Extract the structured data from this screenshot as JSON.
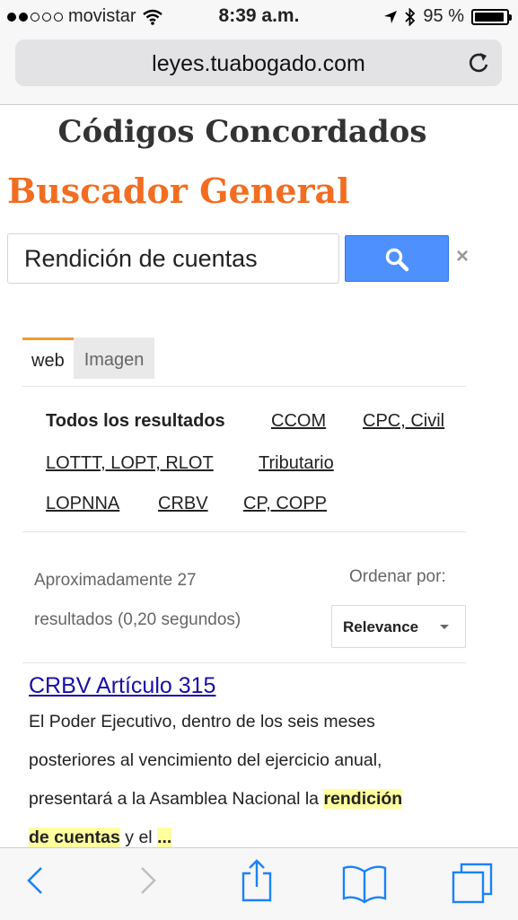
{
  "status_bar": {
    "carrier": "movistar",
    "time": "8:39 a.m.",
    "battery": "95 %",
    "battery_level": 0.95
  },
  "browser": {
    "url": "leyes.tuabogado.com"
  },
  "page": {
    "site_title": "Códigos Concordados",
    "search_heading": "Buscador General"
  },
  "search": {
    "value": "Rendición de cuentas",
    "clear_label": "×"
  },
  "tabs": [
    {
      "label": "web",
      "active": true
    },
    {
      "label": "Imagen",
      "active": false
    }
  ],
  "refinements": [
    "Todos los resultados",
    "CCOM",
    "CPC, Civil",
    "LOTTT, LOPT, RLOT",
    "Tributario",
    "LOPNNA",
    "CRBV",
    "CP, COPP"
  ],
  "results_info": {
    "line1": "Aproximadamente 27",
    "line2": "resultados (0,20 segundos)"
  },
  "sort": {
    "label": "Ordenar por:",
    "selected": "Relevance"
  },
  "result": {
    "title": "CRBV Artículo 315",
    "line1": "El Poder Ejecutivo, dentro de los seis meses",
    "line2": "posteriores al vencimiento del ejercicio anual,",
    "line3": "presentará a la Asamblea Nacional la ",
    "line3_highlight": "rendición",
    "line4_highlight": "de cuentas",
    "line4": " y el ",
    "line4_ellipsis": "..."
  },
  "icons": {
    "wifi": "wifi-icon",
    "location": "location-arrow-icon",
    "bluetooth": "bluetooth-icon",
    "reload": "reload-icon",
    "search": "search-icon",
    "back": "back-chevron-icon",
    "forward": "forward-chevron-icon",
    "share": "share-icon",
    "bookmarks": "bookmarks-icon",
    "tabs": "tabs-icon"
  },
  "colors": {
    "search_heading": "#f26d21",
    "search_button": "#4d90fe",
    "link": "#1a0dab",
    "highlight": "#ffff9e",
    "ios_tint": "#1a82fb"
  }
}
